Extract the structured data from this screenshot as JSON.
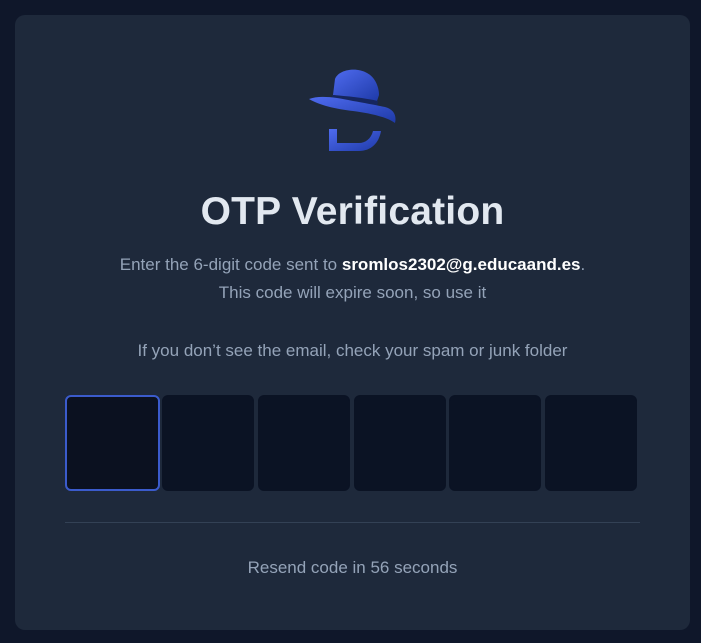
{
  "title": "OTP Verification",
  "instructions": {
    "prefix": "Enter the 6-digit code sent to ",
    "email": "sromlos2302@g.educaand.es",
    "suffix": ".",
    "line2": "This code will expire soon, so use it",
    "line3": "If you don’t see the email, check your spam or junk folder"
  },
  "otp": {
    "digits": [
      "",
      "",
      "",
      "",
      "",
      ""
    ],
    "active_index": 0
  },
  "resend_text": "Resend code in 56 seconds",
  "logo_icon": "detective-hat-logo-icon",
  "colors": {
    "background": "#0f172a",
    "card": "#1e293b",
    "accent": "#3b5bcc",
    "logo_gradient_start": "#3b5bdb",
    "logo_gradient_end": "#1e3aa8"
  }
}
